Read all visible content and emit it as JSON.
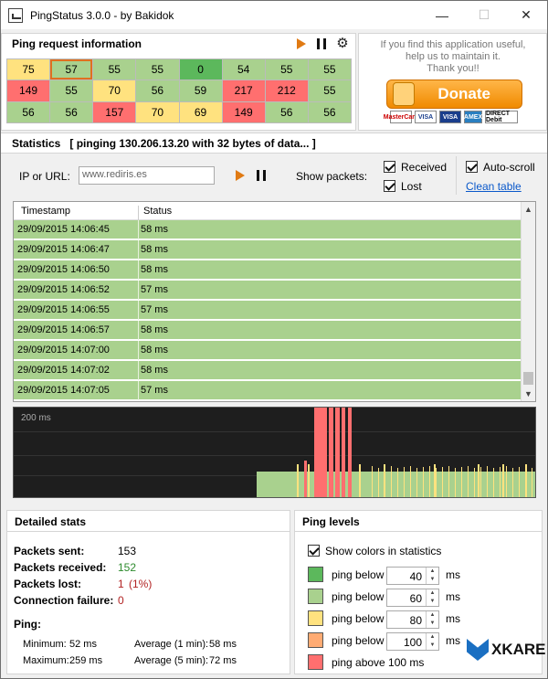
{
  "window": {
    "title": "PingStatus 3.0.0 - by Bakidok"
  },
  "ping_request": {
    "heading": "Ping request information",
    "grid": [
      [
        "75",
        "57",
        "55",
        "55",
        "0",
        "54",
        "55",
        "55"
      ],
      [
        "149",
        "55",
        "70",
        "56",
        "59",
        "217",
        "212",
        "55"
      ],
      [
        "56",
        "56",
        "157",
        "70",
        "69",
        "149",
        "56",
        "56"
      ]
    ],
    "grid_colors": [
      [
        "#ffe27f",
        "#a9d18e",
        "#a9d18e",
        "#a9d18e",
        "#5cb85c",
        "#a9d18e",
        "#a9d18e",
        "#a9d18e"
      ],
      [
        "#ff6f6f",
        "#a9d18e",
        "#ffe27f",
        "#a9d18e",
        "#a9d18e",
        "#ff6f6f",
        "#ff6f6f",
        "#a9d18e"
      ],
      [
        "#a9d18e",
        "#a9d18e",
        "#ff6f6f",
        "#ffe27f",
        "#ffe27f",
        "#ff6f6f",
        "#a9d18e",
        "#a9d18e"
      ]
    ]
  },
  "donate": {
    "message_line1": "If you find this application useful,",
    "message_line2": "help us to maintain it.",
    "message_line3": "Thank you!!",
    "button_label": "Donate",
    "cards": [
      "MasterCard",
      "VISA",
      "VISA",
      "AMEX",
      "DIRECT Debit"
    ]
  },
  "statistics": {
    "heading": "Statistics",
    "status_text": "[ pinging 130.206.13.20 with 32 bytes of data... ]",
    "ip_label": "IP or URL:",
    "ip_value": "www.rediris.es",
    "show_packets_label": "Show packets:",
    "received_label": "Received",
    "lost_label": "Lost",
    "autoscroll_label": "Auto-scroll",
    "clean_table_label": "Clean table"
  },
  "table": {
    "columns": [
      "Timestamp",
      "Status"
    ],
    "rows": [
      {
        "timestamp": "29/09/2015  14:06:45",
        "status": "58 ms"
      },
      {
        "timestamp": "29/09/2015  14:06:47",
        "status": "58 ms"
      },
      {
        "timestamp": "29/09/2015  14:06:50",
        "status": "58 ms"
      },
      {
        "timestamp": "29/09/2015  14:06:52",
        "status": "57 ms"
      },
      {
        "timestamp": "29/09/2015  14:06:55",
        "status": "57 ms"
      },
      {
        "timestamp": "29/09/2015  14:06:57",
        "status": "58 ms"
      },
      {
        "timestamp": "29/09/2015  14:07:00",
        "status": "58 ms"
      },
      {
        "timestamp": "29/09/2015  14:07:02",
        "status": "58 ms"
      },
      {
        "timestamp": "29/09/2015  14:07:05",
        "status": "57 ms"
      }
    ]
  },
  "graph": {
    "label": "200 ms"
  },
  "detailed_stats": {
    "heading": "Detailed stats",
    "packets_sent_label": "Packets sent:",
    "packets_sent": "153",
    "packets_received_label": "Packets received:",
    "packets_received": "152",
    "packets_lost_label": "Packets lost:",
    "packets_lost": "1",
    "packets_lost_pct": "(1%)",
    "connection_failure_label": "Connection failure:",
    "connection_failure": "0",
    "ping_label": "Ping:",
    "minimum_label": "Minimum:",
    "minimum": "52 ms",
    "maximum_label": "Maximum:",
    "maximum": "259 ms",
    "avg1_label": "Average (1 min):",
    "avg1": "58 ms",
    "avg5_label": "Average (5 min):",
    "avg5": "72 ms",
    "colors": {
      "received": "#2e8b2e",
      "lost": "#b22222"
    }
  },
  "ping_levels": {
    "heading": "Ping levels",
    "show_colors_label": "Show colors in statistics",
    "levels": [
      {
        "label": "ping below",
        "value": "40",
        "unit": "ms",
        "color": "#5cb85c"
      },
      {
        "label": "ping below",
        "value": "60",
        "unit": "ms",
        "color": "#a9d18e"
      },
      {
        "label": "ping below",
        "value": "80",
        "unit": "ms",
        "color": "#ffe27f"
      },
      {
        "label": "ping below",
        "value": "100",
        "unit": "ms",
        "color": "#ffab73"
      },
      {
        "label": "ping above 100 ms",
        "value": "",
        "unit": "",
        "color": "#ff6f6f"
      }
    ]
  },
  "brand": {
    "logo_text": "XKARE"
  }
}
